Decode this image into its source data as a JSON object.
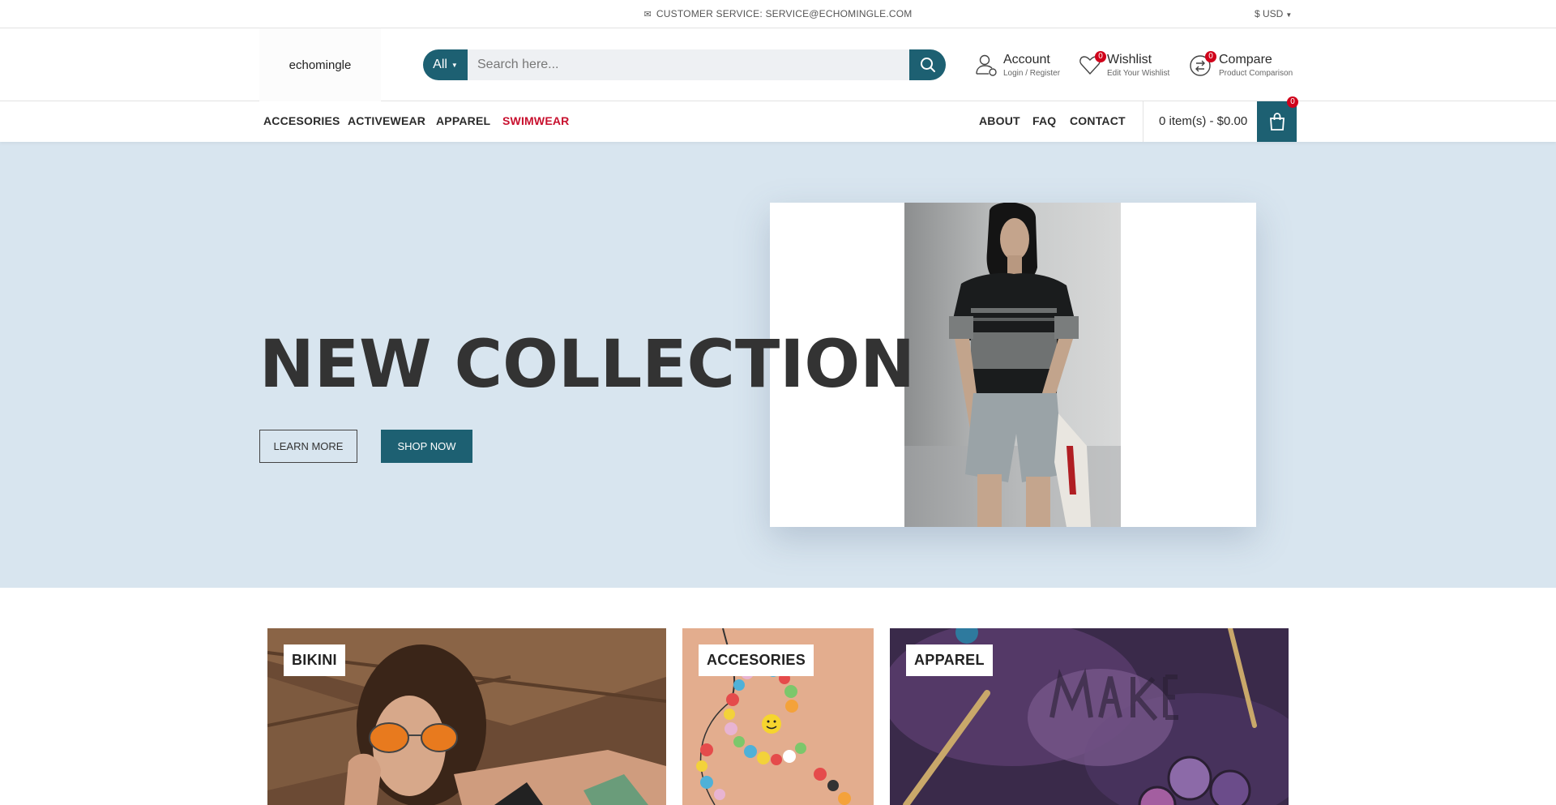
{
  "topbar": {
    "customer_service": "CUSTOMER SERVICE: SERVICE@ECHOMINGLE.COM",
    "currency": "$ USD"
  },
  "header": {
    "logo_text": "echomingle",
    "search": {
      "category": "All",
      "placeholder": "Search here..."
    },
    "account": {
      "title": "Account",
      "subtitle": "Login / Register"
    },
    "wishlist": {
      "title": "Wishlist",
      "subtitle": "Edit Your Wishlist",
      "count": "0"
    },
    "compare": {
      "title": "Compare",
      "subtitle": "Product Comparison",
      "count": "0"
    }
  },
  "nav": {
    "left": [
      "ACCESORIES",
      "ACTIVEWEAR",
      "APPAREL",
      "SWIMWEAR"
    ],
    "right": [
      "ABOUT",
      "FAQ",
      "CONTACT"
    ],
    "cart_text": "0 item(s) - $0.00",
    "cart_count": "0"
  },
  "hero": {
    "title": "NEW COLLECTION",
    "learn_more": "LEARN MORE",
    "shop_now": "SHOP NOW"
  },
  "categories": [
    "BIKINI",
    "ACCESORIES",
    "APPAREL"
  ],
  "colors": {
    "accent": "#1d6072",
    "hero_bg": "#d8e5ef",
    "sale_red": "#c8102e",
    "badge": "#d0021b"
  }
}
